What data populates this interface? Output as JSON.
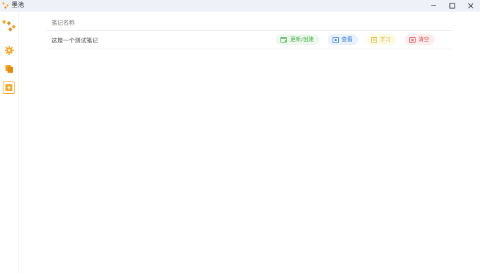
{
  "window": {
    "title": "墨池",
    "controls": {
      "minimize": "–",
      "maximize": "□",
      "close": "✕"
    }
  },
  "sidebar": {
    "logo_icon": "diamond-cluster-logo",
    "items": [
      {
        "name": "settings",
        "icon": "gear-icon"
      },
      {
        "name": "documents",
        "icon": "copy-icon"
      },
      {
        "name": "notes",
        "icon": "note-add-icon",
        "active": true
      }
    ]
  },
  "table": {
    "columns": [
      "笔记名称"
    ],
    "rows": [
      {
        "name": "这是一个测试笔记",
        "actions": {
          "update": "更新/创建",
          "view": "查看",
          "learn": "学习",
          "clear": "清空"
        }
      }
    ]
  },
  "colors": {
    "accent": "#f5a623",
    "update": "#4caf50",
    "view": "#3b82d6",
    "learn": "#d8b73a",
    "clear": "#e05555"
  }
}
